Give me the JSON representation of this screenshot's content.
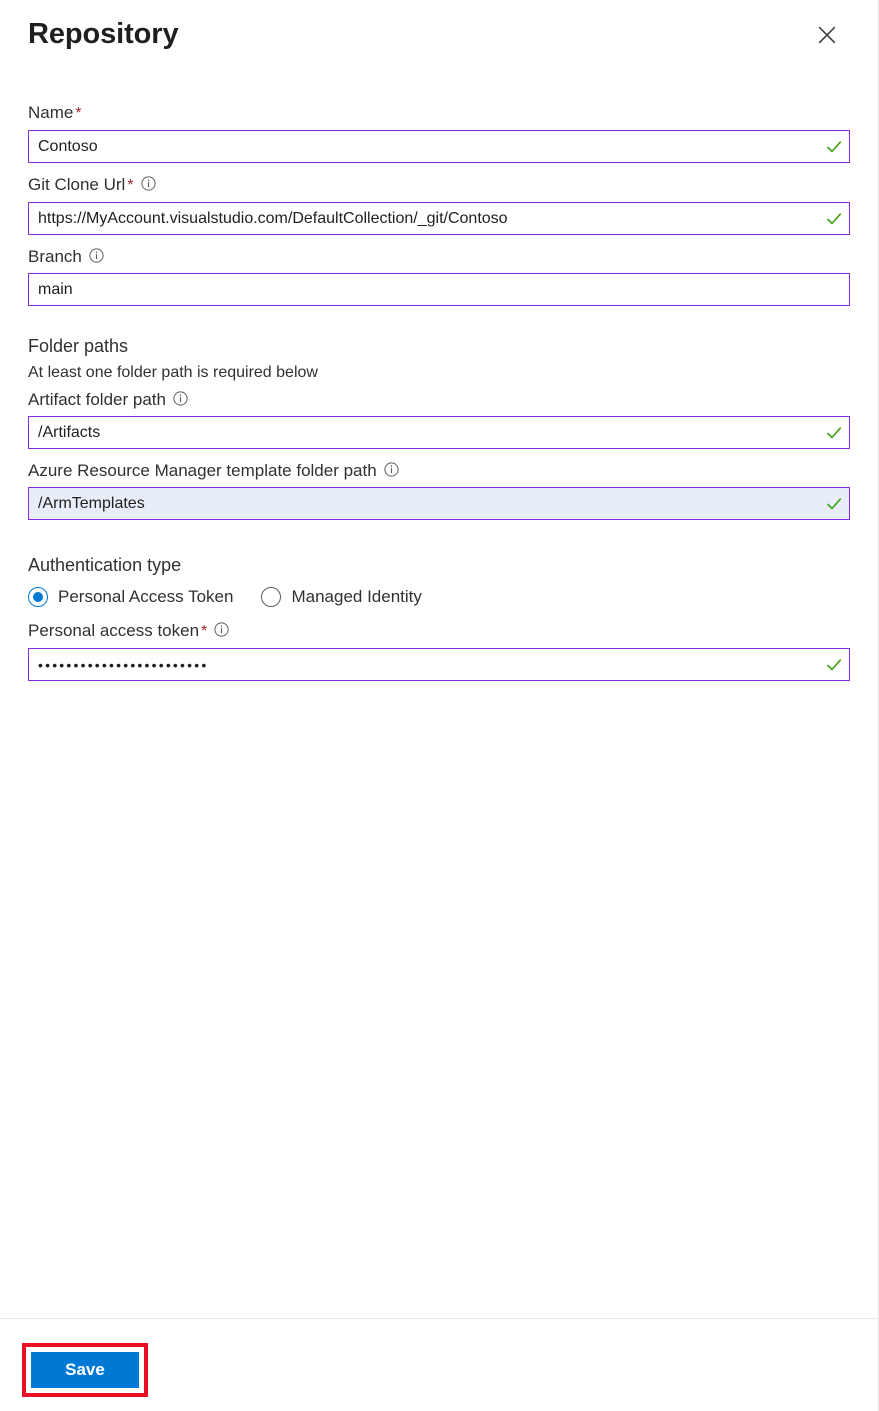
{
  "panel": {
    "title": "Repository",
    "close_label": "Close",
    "close_icon": "close-icon"
  },
  "fields": {
    "name": {
      "label": "Name",
      "required": true,
      "required_marker": "*",
      "value": "Contoso",
      "has_info": false,
      "validated": true,
      "focused": false
    },
    "git_clone_url": {
      "label": "Git Clone Url",
      "required": true,
      "required_marker": "*",
      "value": "https://MyAccount.visualstudio.com/DefaultCollection/_git/Contoso",
      "has_info": true,
      "info_icon": "info-icon",
      "validated": true,
      "focused": false
    },
    "branch": {
      "label": "Branch",
      "required": false,
      "value": "main",
      "has_info": true,
      "info_icon": "info-icon",
      "validated": false,
      "focused": false
    },
    "artifact_folder_path": {
      "label": "Artifact folder path",
      "required": false,
      "value": "/Artifacts",
      "has_info": true,
      "info_icon": "info-icon",
      "validated": true,
      "focused": false
    },
    "arm_template_folder_path": {
      "label": "Azure Resource Manager template folder path",
      "required": false,
      "value": "/ArmTemplates",
      "has_info": true,
      "info_icon": "info-icon",
      "validated": true,
      "focused": true
    },
    "personal_access_token": {
      "label": "Personal access token",
      "required": true,
      "required_marker": "*",
      "value": "????????????????????????",
      "masked_char_count": 24,
      "has_info": true,
      "info_icon": "info-icon",
      "validated": true,
      "focused": false
    }
  },
  "folder_paths_section": {
    "heading": "Folder paths",
    "subtext": "At least one folder path is required below"
  },
  "auth_section": {
    "heading": "Authentication type",
    "options": [
      {
        "label": "Personal Access Token",
        "selected": true
      },
      {
        "label": "Managed Identity",
        "selected": false
      }
    ]
  },
  "footer": {
    "save_label": "Save",
    "save_highlighted": true
  },
  "colors": {
    "accent_blue": "#0078d4",
    "highlight_red": "#e81123",
    "input_border_purple": "#8a2be2",
    "valid_green": "#107c10",
    "required_red": "#a4262c",
    "focused_field_bg": "#e7eef9",
    "text_primary": "#201f1e",
    "text_secondary": "#323130",
    "divider": "#e8e8e8"
  }
}
